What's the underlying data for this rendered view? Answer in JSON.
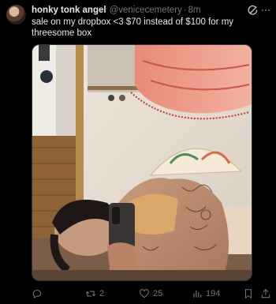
{
  "post": {
    "display_name": "honky tonk angel",
    "handle": "@venicecemetery",
    "separator": "·",
    "time": "8m",
    "text": "sale on my dropbox <3 $70 instead of $100 for my threesome box"
  },
  "actions": {
    "replies": "",
    "reposts": "2",
    "likes": "25",
    "views": "194"
  },
  "icons": {
    "header": [
      "grok-icon",
      "more-icon"
    ],
    "actions": [
      "reply-icon",
      "repost-icon",
      "like-icon",
      "views-icon",
      "bookmark-icon",
      "share-icon"
    ]
  },
  "colors": {
    "background": "#000000",
    "text": "#e7e9ea",
    "secondary": "#71767b"
  }
}
